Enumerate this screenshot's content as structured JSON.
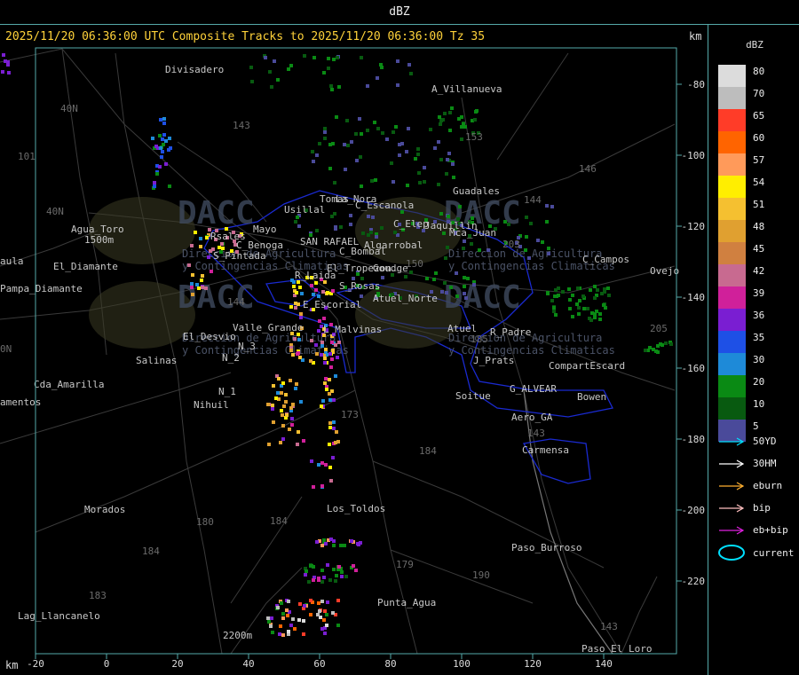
{
  "window_title": "dBZ",
  "header_text": "2025/11/20 06:36:00 UTC Composite Tracks to 2025/11/20 06:36:00 Tz 35",
  "km_label": "km",
  "y_axis": [
    {
      "label": "-80",
      "v": -80
    },
    {
      "label": "-100",
      "v": -100
    },
    {
      "label": "-120",
      "v": -120
    },
    {
      "label": "-140",
      "v": -140
    },
    {
      "label": "-160",
      "v": -160
    },
    {
      "label": "-180",
      "v": -180
    },
    {
      "label": "-200",
      "v": -200
    },
    {
      "label": "-220",
      "v": -220
    }
  ],
  "x_axis": [
    {
      "label": "-20",
      "v": -20
    },
    {
      "label": "0",
      "v": 0
    },
    {
      "label": "20",
      "v": 20
    },
    {
      "label": "40",
      "v": 40
    },
    {
      "label": "60",
      "v": 60
    },
    {
      "label": "80",
      "v": 80
    },
    {
      "label": "100",
      "v": 100
    },
    {
      "label": "120",
      "v": 120
    },
    {
      "label": "140",
      "v": 140
    }
  ],
  "legend": {
    "title": "dBZ",
    "scale": [
      {
        "label": "80",
        "color": "#dcdcdc"
      },
      {
        "label": "70",
        "color": "#bdbdbd"
      },
      {
        "label": "65",
        "color": "#ff3c28"
      },
      {
        "label": "60",
        "color": "#ff6400"
      },
      {
        "label": "57",
        "color": "#ff9a5a"
      },
      {
        "label": "54",
        "color": "#ffee00"
      },
      {
        "label": "51",
        "color": "#f5c030"
      },
      {
        "label": "48",
        "color": "#e0a030"
      },
      {
        "label": "45",
        "color": "#d08040"
      },
      {
        "label": "42",
        "color": "#c86a90"
      },
      {
        "label": "39",
        "color": "#d0209a"
      },
      {
        "label": "36",
        "color": "#7a1ed2"
      },
      {
        "label": "35",
        "color": "#1e50e6"
      },
      {
        "label": "30",
        "color": "#1e8ad8"
      },
      {
        "label": "20",
        "color": "#0a8a14"
      },
      {
        "label": "10",
        "color": "#085a10"
      },
      {
        "label": "5",
        "color": "#4a4a9a"
      }
    ],
    "tracks": [
      {
        "label": "50YD",
        "color": "#00e0ff"
      },
      {
        "label": "30HM",
        "color": "#ffffff"
      },
      {
        "label": "eburn",
        "color": "#ffb030"
      },
      {
        "label": "bip",
        "color": "#ffc0c0"
      },
      {
        "label": "eb+bip",
        "color": "#e020e0"
      }
    ],
    "current_label": "current",
    "current_color": "#00e0ff"
  },
  "place_names": [
    {
      "name": "Divisadero"
    },
    {
      "name": "A_Villanueva"
    },
    {
      "name": "Guadales"
    },
    {
      "name": "Tomas"
    },
    {
      "name": "Usillal"
    },
    {
      "name": "La_Nora"
    },
    {
      "name": "C_Escanola"
    },
    {
      "name": "C_Elep"
    },
    {
      "name": "Jaquillin"
    },
    {
      "name": "Mca_Juan"
    },
    {
      "name": "Agua_Toro"
    },
    {
      "name": "1500m"
    },
    {
      "name": "Rsales"
    },
    {
      "name": "Mayo"
    },
    {
      "name": "C_Benoga"
    },
    {
      "name": "SAN RAFAEL"
    },
    {
      "name": "Algarrobal"
    },
    {
      "name": "C_Bombal"
    },
    {
      "name": "S_Pintada"
    },
    {
      "name": "El_Tropezon"
    },
    {
      "name": "Goudge"
    },
    {
      "name": "Pampa_Diamante"
    },
    {
      "name": "R_Laida"
    },
    {
      "name": "S_Rosas"
    },
    {
      "name": "Atuel_Norte"
    },
    {
      "name": "C_Campos"
    },
    {
      "name": "Valle_Grande"
    },
    {
      "name": "E_Escorial"
    },
    {
      "name": "L_Malvinas"
    },
    {
      "name": "Atuel"
    },
    {
      "name": "R_Padre"
    },
    {
      "name": "El_Desvio"
    },
    {
      "name": "N_3"
    },
    {
      "name": "N_2"
    },
    {
      "name": "Salinas"
    },
    {
      "name": "J_Prats"
    },
    {
      "name": "CompartEscard"
    },
    {
      "name": "Cda_Amarilla"
    },
    {
      "name": "N_1"
    },
    {
      "name": "Nihuil"
    },
    {
      "name": "G_ALVEAR"
    },
    {
      "name": "Soitue"
    },
    {
      "name": "Bowen"
    },
    {
      "name": "Aero_GA"
    },
    {
      "name": "amentos"
    },
    {
      "name": "Carmensa"
    },
    {
      "name": "Morados"
    },
    {
      "name": "Los_Toldos"
    },
    {
      "name": "Paso_Burroso"
    },
    {
      "name": "Punta_Agua"
    },
    {
      "name": "Lag_Llancanelo"
    },
    {
      "name": "Paso_El_Loro"
    },
    {
      "name": "Ovejo"
    },
    {
      "name": "2200m"
    },
    {
      "name": "aula"
    },
    {
      "name": "El_Diamante"
    }
  ],
  "route_labels": [
    {
      "name": "40N"
    },
    {
      "name": "40N"
    },
    {
      "name": "101"
    },
    {
      "name": "143"
    },
    {
      "name": "153"
    },
    {
      "name": "146"
    },
    {
      "name": "144"
    },
    {
      "name": "144"
    },
    {
      "name": "203"
    },
    {
      "name": "173"
    },
    {
      "name": "184"
    },
    {
      "name": "180"
    },
    {
      "name": "184"
    },
    {
      "name": "184"
    },
    {
      "name": "183"
    },
    {
      "name": "179"
    },
    {
      "name": "190"
    },
    {
      "name": "143"
    },
    {
      "name": "143"
    },
    {
      "name": "205"
    },
    {
      "name": "185"
    },
    {
      "name": "150"
    },
    {
      "name": "0N"
    }
  ],
  "watermark": {
    "logo_text": "DACC",
    "line1": "Direccion de Agricultura",
    "line2": "y Contingencias Climaticas"
  }
}
